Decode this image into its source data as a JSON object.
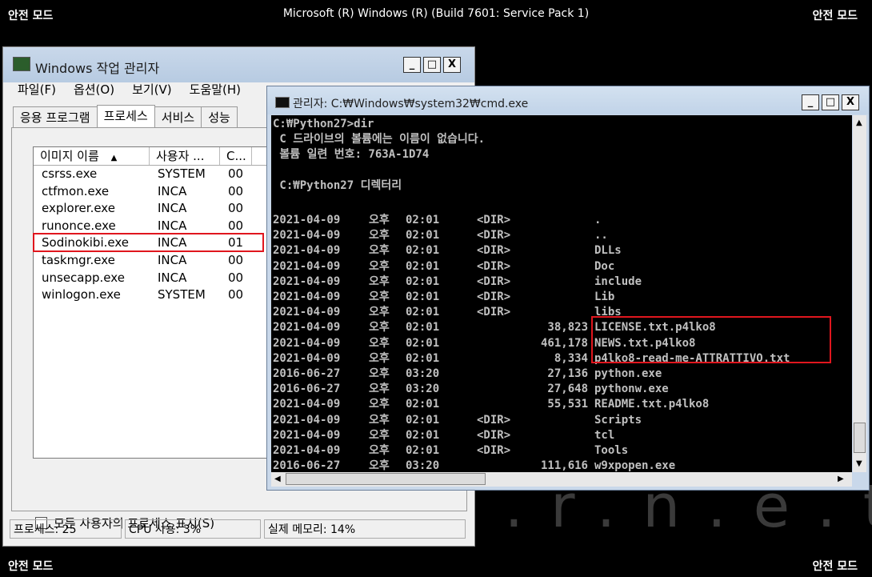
{
  "screen": {
    "safe_mode": "안전 모드",
    "build": "Microsoft (R) Windows (R) (Build 7601: Service Pack 1)",
    "watermark": "i.n.t.e.r.n.e.t"
  },
  "taskmgr": {
    "title": "Windows 작업 관리자",
    "menu": [
      "파일(F)",
      "옵션(O)",
      "보기(V)",
      "도움말(H)"
    ],
    "tabs": [
      "응용 프로그램",
      "프로세스",
      "서비스",
      "성능"
    ],
    "columns": [
      "이미지 이름",
      "사용자 ...",
      "C..."
    ],
    "sort_arrow": "▲",
    "processes": [
      {
        "name": "csrss.exe",
        "user": "SYSTEM",
        "cpu": "00"
      },
      {
        "name": "ctfmon.exe",
        "user": "INCA",
        "cpu": "00"
      },
      {
        "name": "explorer.exe",
        "user": "INCA",
        "cpu": "00"
      },
      {
        "name": "runonce.exe",
        "user": "INCA",
        "cpu": "00"
      },
      {
        "name": "Sodinokibi.exe",
        "user": "INCA",
        "cpu": "01"
      },
      {
        "name": "taskmgr.exe",
        "user": "INCA",
        "cpu": "00"
      },
      {
        "name": "unsecapp.exe",
        "user": "INCA",
        "cpu": "00"
      },
      {
        "name": "winlogon.exe",
        "user": "SYSTEM",
        "cpu": "00"
      }
    ],
    "show_all_label": "모든 사용자의 프로세스 표시(S)",
    "status": {
      "processes": "프로세스: 25",
      "cpu": "CPU 사용: 3%",
      "memory": "실제 메모리: 14%"
    }
  },
  "cmd": {
    "title": "관리자: C:₩Windows₩system32₩cmd.exe",
    "header_lines": [
      "C:₩Python27>dir",
      " C 드라이브의 볼륨에는 이름이 없습니다.",
      " 볼륨 일련 번호: 763A-1D74",
      "",
      " C:₩Python27 디렉터리",
      ""
    ],
    "entries": [
      {
        "date": "2021-04-09",
        "ampm": "오후",
        "time": "02:01",
        "dir": "<DIR>",
        "size": "",
        "name": "."
      },
      {
        "date": "2021-04-09",
        "ampm": "오후",
        "time": "02:01",
        "dir": "<DIR>",
        "size": "",
        "name": ".."
      },
      {
        "date": "2021-04-09",
        "ampm": "오후",
        "time": "02:01",
        "dir": "<DIR>",
        "size": "",
        "name": "DLLs"
      },
      {
        "date": "2021-04-09",
        "ampm": "오후",
        "time": "02:01",
        "dir": "<DIR>",
        "size": "",
        "name": "Doc"
      },
      {
        "date": "2021-04-09",
        "ampm": "오후",
        "time": "02:01",
        "dir": "<DIR>",
        "size": "",
        "name": "include"
      },
      {
        "date": "2021-04-09",
        "ampm": "오후",
        "time": "02:01",
        "dir": "<DIR>",
        "size": "",
        "name": "Lib"
      },
      {
        "date": "2021-04-09",
        "ampm": "오후",
        "time": "02:01",
        "dir": "<DIR>",
        "size": "",
        "name": "libs"
      },
      {
        "date": "2021-04-09",
        "ampm": "오후",
        "time": "02:01",
        "dir": "",
        "size": "38,823",
        "name": "LICENSE.txt.p4lko8"
      },
      {
        "date": "2021-04-09",
        "ampm": "오후",
        "time": "02:01",
        "dir": "",
        "size": "461,178",
        "name": "NEWS.txt.p4lko8"
      },
      {
        "date": "2021-04-09",
        "ampm": "오후",
        "time": "02:01",
        "dir": "",
        "size": "8,334",
        "name": "p4lko8-read-me-ATTRATTIVO.txt"
      },
      {
        "date": "2016-06-27",
        "ampm": "오후",
        "time": "03:20",
        "dir": "",
        "size": "27,136",
        "name": "python.exe"
      },
      {
        "date": "2016-06-27",
        "ampm": "오후",
        "time": "03:20",
        "dir": "",
        "size": "27,648",
        "name": "pythonw.exe"
      },
      {
        "date": "2021-04-09",
        "ampm": "오후",
        "time": "02:01",
        "dir": "",
        "size": "55,531",
        "name": "README.txt.p4lko8"
      },
      {
        "date": "2021-04-09",
        "ampm": "오후",
        "time": "02:01",
        "dir": "<DIR>",
        "size": "",
        "name": "Scripts"
      },
      {
        "date": "2021-04-09",
        "ampm": "오후",
        "time": "02:01",
        "dir": "<DIR>",
        "size": "",
        "name": "tcl"
      },
      {
        "date": "2021-04-09",
        "ampm": "오후",
        "time": "02:01",
        "dir": "<DIR>",
        "size": "",
        "name": "Tools"
      },
      {
        "date": "2016-06-27",
        "ampm": "오후",
        "time": "03:20",
        "dir": "",
        "size": "111,616",
        "name": "w9xpopen.exe"
      }
    ]
  },
  "window_buttons": {
    "minimize": "_",
    "maximize": "□",
    "close": "X"
  },
  "colors": {
    "highlight": "#e0161e",
    "console_bg": "#000000",
    "console_fg": "#c0c0c0"
  }
}
